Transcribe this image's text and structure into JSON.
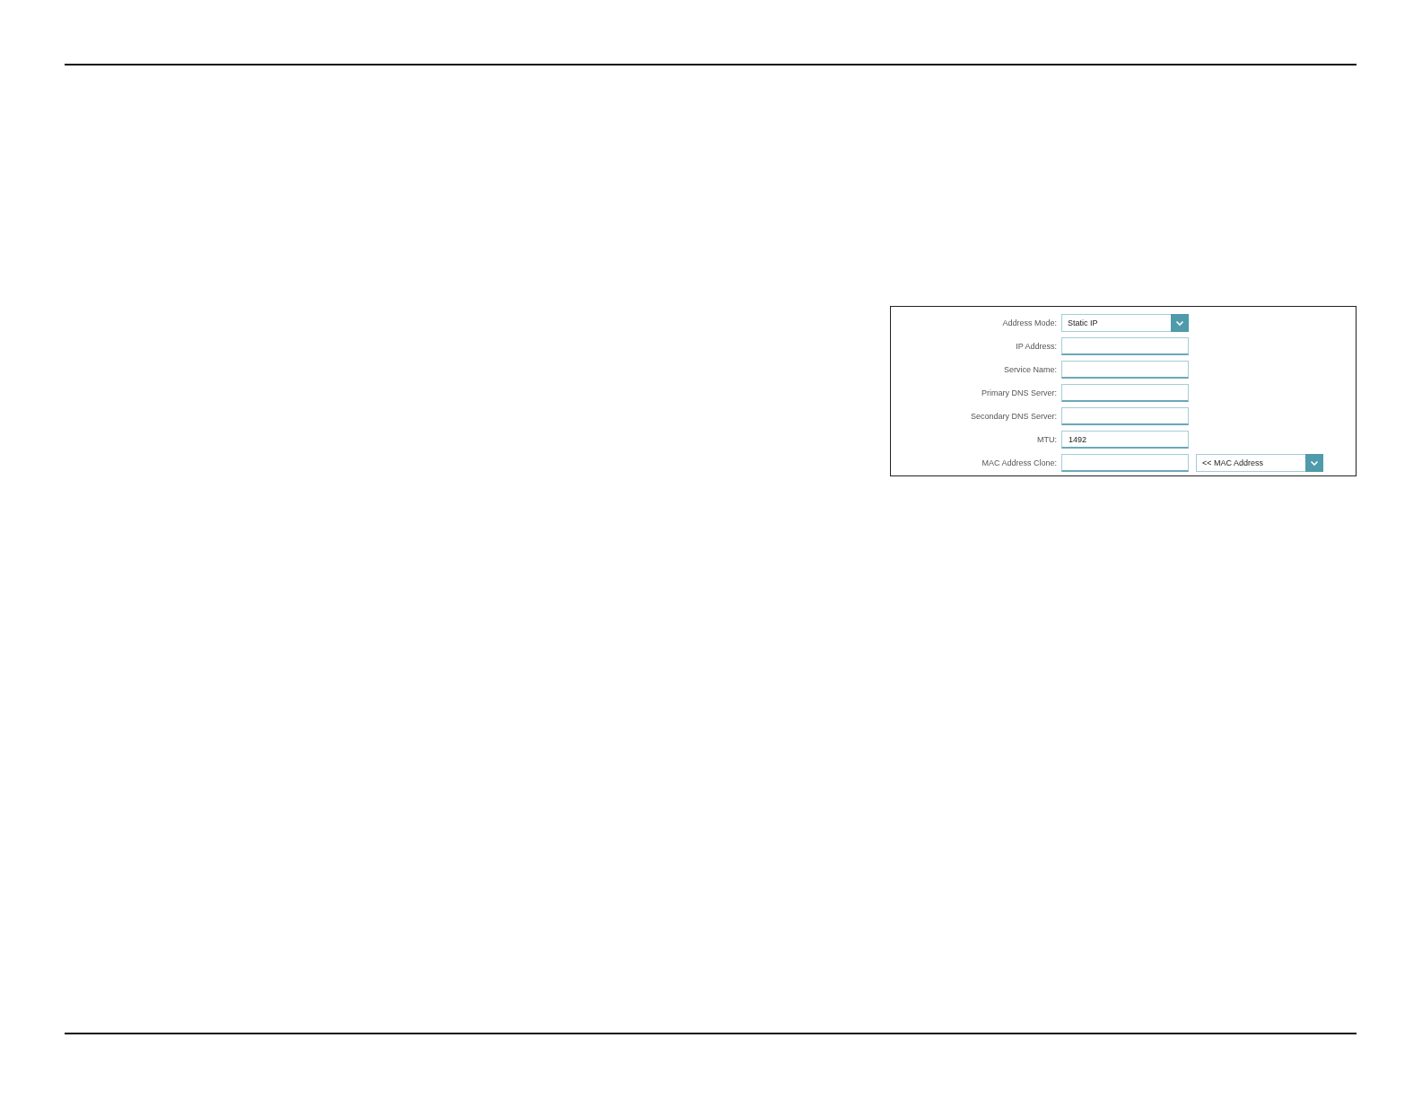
{
  "form": {
    "fields": [
      {
        "kind": "select",
        "label": "Address Mode:",
        "value": "Static IP"
      },
      {
        "kind": "input",
        "label": "IP Address:"
      },
      {
        "kind": "input",
        "label": "Service Name:"
      },
      {
        "kind": "input",
        "label": "Primary DNS Server:"
      },
      {
        "kind": "input",
        "label": "Secondary DNS Server:"
      },
      {
        "kind": "input",
        "label": "MTU:",
        "value": "1492"
      },
      {
        "kind": "input_select",
        "label": "MAC Address Clone:",
        "select_value": "<< MAC Address"
      }
    ]
  }
}
